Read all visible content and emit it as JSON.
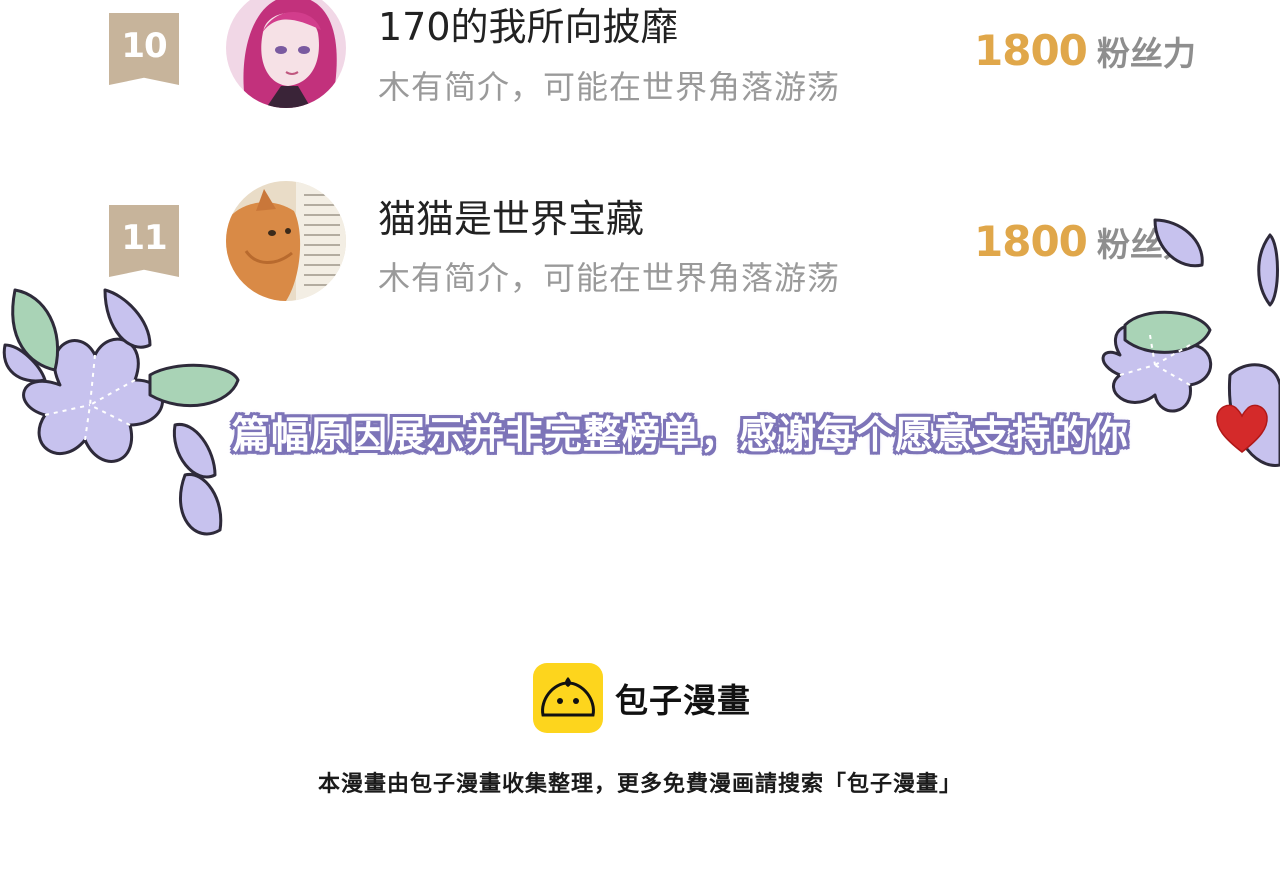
{
  "ranking": {
    "rows": [
      {
        "rank": "10",
        "name": "170的我所向披靡",
        "bio": "木有简介，可能在世界角落游荡",
        "score": "1800",
        "score_unit": "粉丝力",
        "avatar_icon": "anime-girl-avatar"
      },
      {
        "rank": "11",
        "name": "猫猫是世界宝藏",
        "bio": "木有简介，可能在世界角落游荡",
        "score": "1800",
        "score_unit": "粉丝力",
        "avatar_icon": "cat-avatar"
      }
    ],
    "badge_color": "#c7b49b"
  },
  "banner": {
    "text": "篇幅原因展示并非完整榜单，感谢每个愿意支持的你",
    "heart_icon": "heart-icon",
    "outline_color": "#7d74b8"
  },
  "decorations": {
    "flower_icon": "purple-flower-icon",
    "leaf_icon": "green-leaf-icon",
    "flower_color": "#c7c2ee",
    "leaf_color": "#a9d3b6"
  },
  "branding": {
    "logo_icon": "bun-logo-icon",
    "app_name": "包子漫畫",
    "note": "本漫畫由包子漫畫收集整理，更多免費漫画請搜索「包子漫畫」",
    "accent": "#fdd51d"
  }
}
